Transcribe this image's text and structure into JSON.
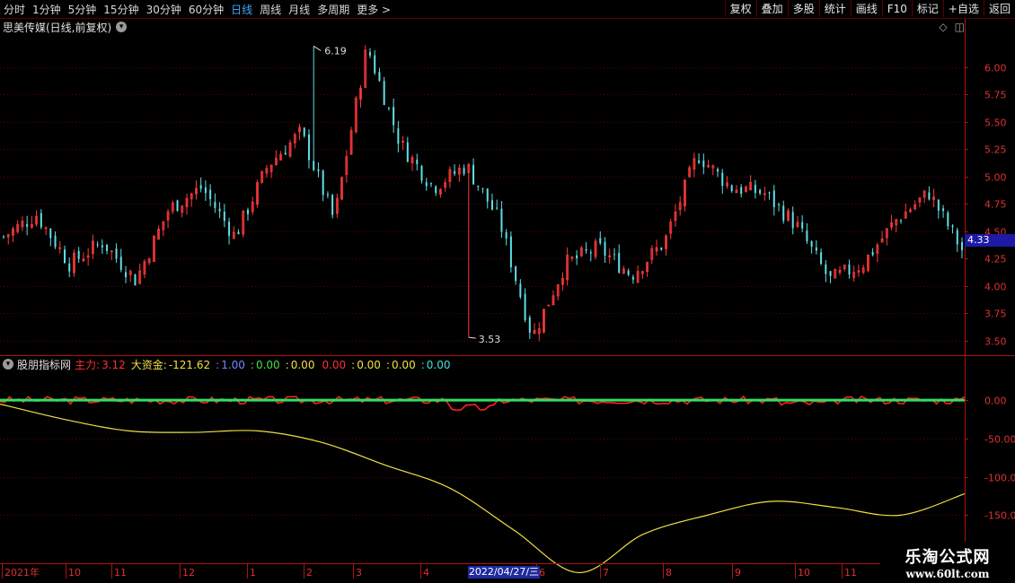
{
  "toolbar": {
    "periods": [
      "分时",
      "1分钟",
      "5分钟",
      "15分钟",
      "30分钟",
      "60分钟",
      "日线",
      "周线",
      "月线",
      "多周期",
      "更多 >"
    ],
    "active_period_index": 6,
    "actions": [
      "复权",
      "叠加",
      "多股",
      "统计",
      "画线",
      "F10",
      "标记",
      "+自选",
      "返回"
    ]
  },
  "main": {
    "title": "思美传媒(日线,前复权)",
    "price_tag": "4.33",
    "high_label": "6.19",
    "low_label": "3.53"
  },
  "indicator": {
    "name": "股朋指标网",
    "fields": [
      {
        "label": "主力:",
        "value": "3.12",
        "color": "#ff3030"
      },
      {
        "label": "大资金:",
        "value": "-121.62",
        "color": "#f0e040"
      },
      {
        "label": ":",
        "value": "1.00",
        "color": "#6f8cff"
      },
      {
        "label": ":",
        "value": "0.00",
        "color": "#40e040"
      },
      {
        "label": ":",
        "value": "0.00",
        "color": "#f0e040"
      },
      {
        "label": "",
        "value": "0.00",
        "color": "#ff3030"
      },
      {
        "label": ":",
        "value": "0.00",
        "color": "#f0e040"
      },
      {
        "label": ":",
        "value": "0.00",
        "color": "#f0e040"
      },
      {
        "label": ":",
        "value": "0.00",
        "color": "#40e0e0"
      }
    ]
  },
  "time_axis": {
    "labels": [
      "2021年",
      "10",
      "11",
      "12",
      "1",
      "2",
      "3",
      "4",
      "6",
      "7",
      "8",
      "9",
      "10",
      "11"
    ],
    "cursor_date": "2022/04/27/三"
  },
  "watermark": {
    "line1": "乐淘公式网",
    "line2": "www.60lt.com"
  },
  "colors": {
    "up": "#ff3b3b",
    "down": "#5fe0e6",
    "grid": "#5a0000",
    "axis": "#b01010",
    "signal": "#30e060",
    "fund": "#f0e040"
  },
  "chart_data": [
    {
      "type": "candlestick",
      "title": "思美传媒(日线,前复权)",
      "ylim": [
        3.4,
        6.3
      ],
      "y_ticks": [
        3.5,
        3.75,
        4.0,
        4.25,
        4.5,
        4.75,
        5.0,
        5.25,
        5.5,
        5.75,
        6.0
      ],
      "approx_close_path": [
        {
          "x": "2021-09",
          "y": 4.45
        },
        {
          "x": "2021-09",
          "y": 4.65
        },
        {
          "x": "2021-10",
          "y": 4.2
        },
        {
          "x": "2021-10",
          "y": 4.4
        },
        {
          "x": "2021-11",
          "y": 4.05
        },
        {
          "x": "2021-11",
          "y": 4.7
        },
        {
          "x": "2021-12",
          "y": 4.9
        },
        {
          "x": "2021-12",
          "y": 4.45
        },
        {
          "x": "2022-01",
          "y": 5.1
        },
        {
          "x": "2022-01",
          "y": 5.4
        },
        {
          "x": "2022-02",
          "y": 4.6
        },
        {
          "x": "2022-02",
          "y": 6.19
        },
        {
          "x": "2022-03",
          "y": 5.3
        },
        {
          "x": "2022-03",
          "y": 4.9
        },
        {
          "x": "2022-04",
          "y": 5.1
        },
        {
          "x": "2022-04",
          "y": 4.6
        },
        {
          "x": "2022-04",
          "y": 3.53
        },
        {
          "x": "2022-06",
          "y": 4.2
        },
        {
          "x": "2022-06",
          "y": 4.35
        },
        {
          "x": "2022-07",
          "y": 4.1
        },
        {
          "x": "2022-07",
          "y": 4.4
        },
        {
          "x": "2022-08",
          "y": 5.2
        },
        {
          "x": "2022-08",
          "y": 4.9
        },
        {
          "x": "2022-09",
          "y": 4.85
        },
        {
          "x": "2022-09",
          "y": 4.55
        },
        {
          "x": "2022-10",
          "y": 4.05
        },
        {
          "x": "2022-10",
          "y": 4.2
        },
        {
          "x": "2022-11",
          "y": 4.6
        },
        {
          "x": "2022-11",
          "y": 4.85
        },
        {
          "x": "2022-11",
          "y": 4.33
        }
      ],
      "high": 6.19,
      "low": 3.53,
      "last": 4.33
    },
    {
      "type": "line",
      "title": "股朋指标网",
      "ylim": [
        -180,
        40
      ],
      "y_ticks": [
        0.0,
        -50.0,
        -100.0,
        -150.0
      ],
      "series": [
        {
          "name": "大资金",
          "color": "#f0e040",
          "x": [
            "2021-09",
            "2021-10",
            "2021-11",
            "2021-12",
            "2022-01",
            "2022-02",
            "2022-03",
            "2022-04",
            "2022-05",
            "2022-06",
            "2022-07",
            "2022-08",
            "2022-09",
            "2022-10",
            "2022-11",
            "2022-12"
          ],
          "values": [
            -5,
            -25,
            -40,
            -42,
            -40,
            -55,
            -85,
            -115,
            -170,
            -225,
            -175,
            -150,
            -132,
            -140,
            -150,
            -122
          ]
        },
        {
          "name": "主力",
          "color": "#ff3030",
          "value": 3.12
        }
      ]
    }
  ]
}
